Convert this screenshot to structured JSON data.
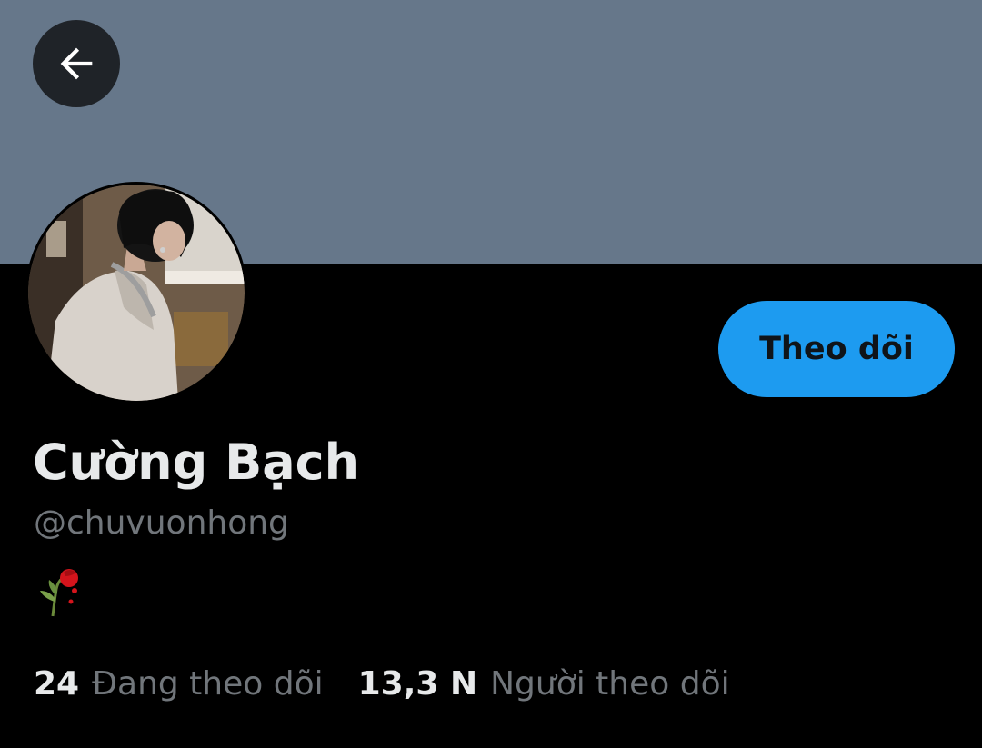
{
  "profile": {
    "display_name": "Cường Bạch",
    "handle": "@chuvuonhong",
    "bio_emoji": "wilted-rose-emoji",
    "follow_label": "Theo dõi"
  },
  "stats": {
    "following_count": "24",
    "following_label": "Đang theo dõi",
    "followers_count": "13,3 N",
    "followers_label": "Người theo dõi"
  },
  "icons": {
    "back": "arrow-left-icon"
  },
  "colors": {
    "banner": "#66778a",
    "background": "#000000",
    "accent": "#1d9bf0",
    "primary_text": "#e7e9ea",
    "secondary_text": "#71767b"
  }
}
